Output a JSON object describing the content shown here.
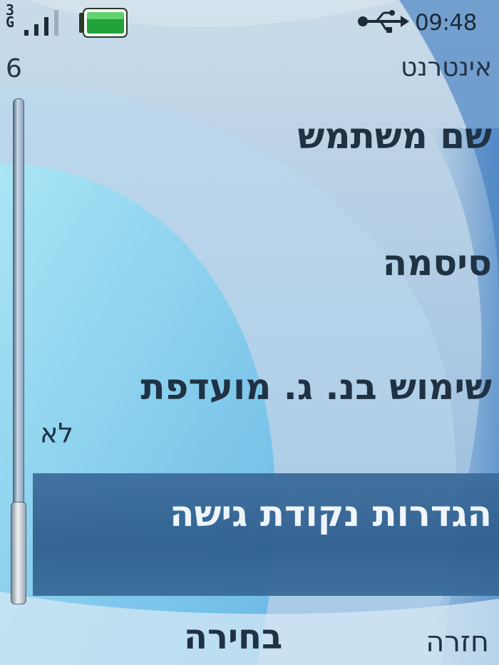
{
  "status_bar": {
    "network": [
      "3",
      "G"
    ],
    "time": "09:48",
    "signal_icon": "signal-bars-icon",
    "battery_icon": "battery-full-icon",
    "usb_icon": "usb-icon"
  },
  "header": {
    "title": "אינטרנט",
    "item_count": "6"
  },
  "menu": {
    "items": [
      {
        "label": "שם משתמש"
      },
      {
        "label": "סיסמה"
      },
      {
        "label": "שימוש בנ. ג. מועדפת",
        "value": "לא"
      },
      {
        "label": "הגדרות נקודת גישה",
        "selected": true
      }
    ]
  },
  "softkeys": {
    "select": "בחירה",
    "back": "חזרה"
  },
  "scroll": {
    "position_fraction": 0.8
  },
  "colors": {
    "selection": "#2f5f8e",
    "text": "#1f3244",
    "selected_text": "#f4f8fc"
  }
}
